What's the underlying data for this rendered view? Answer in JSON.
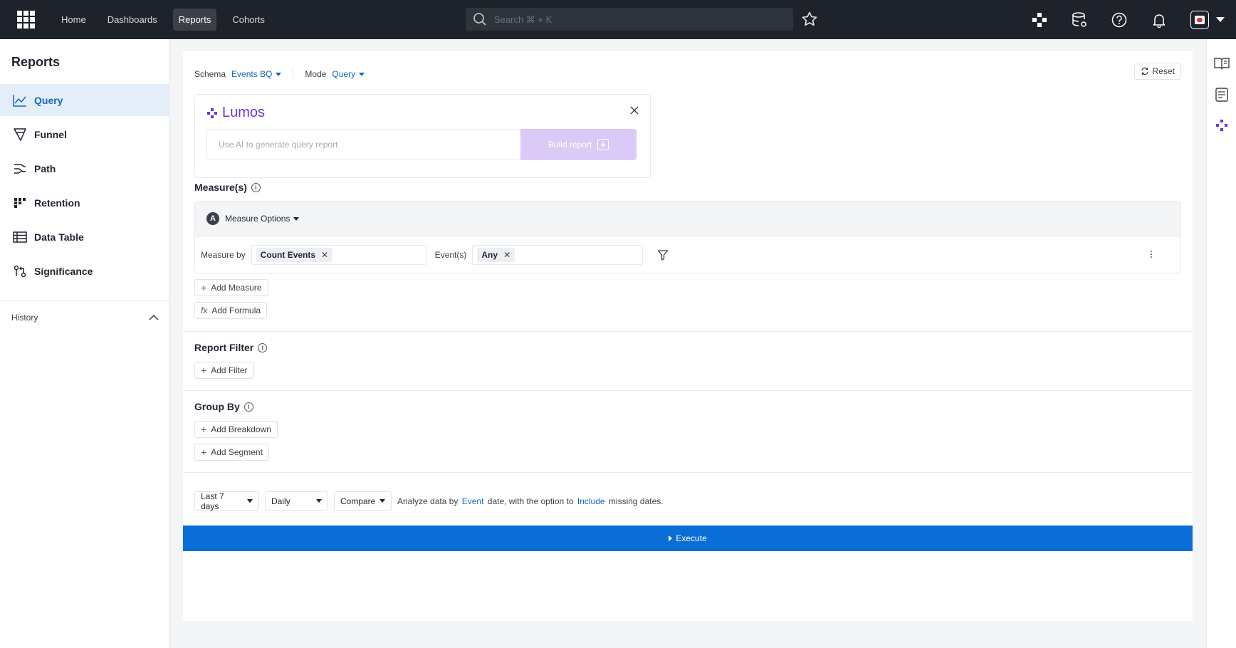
{
  "topbar": {
    "nav": [
      "Home",
      "Dashboards",
      "Reports",
      "Cohorts"
    ],
    "active_nav": "Reports",
    "search_placeholder": "Search ⌘ + K"
  },
  "sidebar": {
    "title": "Reports",
    "items": [
      {
        "label": "Query",
        "icon": "line-chart-icon",
        "active": true
      },
      {
        "label": "Funnel",
        "icon": "funnel-icon",
        "active": false
      },
      {
        "label": "Path",
        "icon": "path-icon",
        "active": false
      },
      {
        "label": "Retention",
        "icon": "retention-grid-icon",
        "active": false
      },
      {
        "label": "Data Table",
        "icon": "table-icon",
        "active": false
      },
      {
        "label": "Significance",
        "icon": "significance-icon",
        "active": false
      }
    ],
    "history_label": "History"
  },
  "toolbar": {
    "schema_label": "Schema",
    "schema_value": "Events BQ",
    "mode_label": "Mode",
    "mode_value": "Query",
    "reset_label": "Reset"
  },
  "lumos": {
    "title": "Lumos",
    "input_placeholder": "Use AI to generate query report",
    "build_label": "Build report"
  },
  "measures": {
    "title": "Measure(s)",
    "badge": "A",
    "options_label": "Measure Options",
    "measure_by_label": "Measure by",
    "measure_chip": "Count Events",
    "events_label": "Event(s)",
    "events_chip": "Any",
    "add_measure": "Add Measure",
    "add_formula": "Add Formula"
  },
  "report_filter": {
    "title": "Report Filter",
    "add_filter": "Add Filter"
  },
  "group_by": {
    "title": "Group By",
    "add_breakdown": "Add Breakdown",
    "add_segment": "Add Segment"
  },
  "footer": {
    "range": "Last 7 days",
    "granularity": "Daily",
    "compare": "Compare",
    "analyze_prefix": "Analyze data by",
    "analyze_link1": "Event",
    "analyze_mid": "date, with the option to",
    "analyze_link2": "Include",
    "analyze_suffix": "missing dates.",
    "execute_label": "Execute"
  },
  "colors": {
    "accent": "#1067c4",
    "execute": "#0b6dd6",
    "lumos": "#6a34d6",
    "topbar": "#1e232b"
  }
}
